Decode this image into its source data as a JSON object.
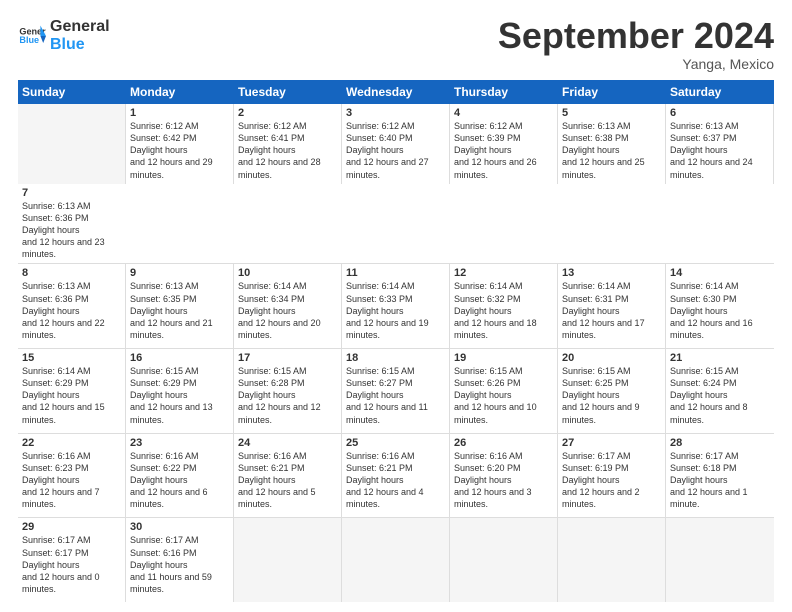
{
  "header": {
    "logo_general": "General",
    "logo_blue": "Blue",
    "month_title": "September 2024",
    "subtitle": "Yanga, Mexico"
  },
  "days": [
    "Sunday",
    "Monday",
    "Tuesday",
    "Wednesday",
    "Thursday",
    "Friday",
    "Saturday"
  ],
  "rows": [
    [
      {
        "day": "",
        "empty": true
      },
      {
        "day": "1",
        "rise": "6:12 AM",
        "set": "6:42 PM",
        "daylight": "12 hours and 29 minutes."
      },
      {
        "day": "2",
        "rise": "6:12 AM",
        "set": "6:41 PM",
        "daylight": "12 hours and 28 minutes."
      },
      {
        "day": "3",
        "rise": "6:12 AM",
        "set": "6:40 PM",
        "daylight": "12 hours and 27 minutes."
      },
      {
        "day": "4",
        "rise": "6:12 AM",
        "set": "6:39 PM",
        "daylight": "12 hours and 26 minutes."
      },
      {
        "day": "5",
        "rise": "6:13 AM",
        "set": "6:38 PM",
        "daylight": "12 hours and 25 minutes."
      },
      {
        "day": "6",
        "rise": "6:13 AM",
        "set": "6:37 PM",
        "daylight": "12 hours and 24 minutes."
      },
      {
        "day": "7",
        "rise": "6:13 AM",
        "set": "6:36 PM",
        "daylight": "12 hours and 23 minutes."
      }
    ],
    [
      {
        "day": "8",
        "rise": "6:13 AM",
        "set": "6:36 PM",
        "daylight": "12 hours and 22 minutes."
      },
      {
        "day": "9",
        "rise": "6:13 AM",
        "set": "6:35 PM",
        "daylight": "12 hours and 21 minutes."
      },
      {
        "day": "10",
        "rise": "6:14 AM",
        "set": "6:34 PM",
        "daylight": "12 hours and 20 minutes."
      },
      {
        "day": "11",
        "rise": "6:14 AM",
        "set": "6:33 PM",
        "daylight": "12 hours and 19 minutes."
      },
      {
        "day": "12",
        "rise": "6:14 AM",
        "set": "6:32 PM",
        "daylight": "12 hours and 18 minutes."
      },
      {
        "day": "13",
        "rise": "6:14 AM",
        "set": "6:31 PM",
        "daylight": "12 hours and 17 minutes."
      },
      {
        "day": "14",
        "rise": "6:14 AM",
        "set": "6:30 PM",
        "daylight": "12 hours and 16 minutes."
      }
    ],
    [
      {
        "day": "15",
        "rise": "6:14 AM",
        "set": "6:29 PM",
        "daylight": "12 hours and 15 minutes."
      },
      {
        "day": "16",
        "rise": "6:15 AM",
        "set": "6:29 PM",
        "daylight": "12 hours and 13 minutes."
      },
      {
        "day": "17",
        "rise": "6:15 AM",
        "set": "6:28 PM",
        "daylight": "12 hours and 12 minutes."
      },
      {
        "day": "18",
        "rise": "6:15 AM",
        "set": "6:27 PM",
        "daylight": "12 hours and 11 minutes."
      },
      {
        "day": "19",
        "rise": "6:15 AM",
        "set": "6:26 PM",
        "daylight": "12 hours and 10 minutes."
      },
      {
        "day": "20",
        "rise": "6:15 AM",
        "set": "6:25 PM",
        "daylight": "12 hours and 9 minutes."
      },
      {
        "day": "21",
        "rise": "6:15 AM",
        "set": "6:24 PM",
        "daylight": "12 hours and 8 minutes."
      }
    ],
    [
      {
        "day": "22",
        "rise": "6:16 AM",
        "set": "6:23 PM",
        "daylight": "12 hours and 7 minutes."
      },
      {
        "day": "23",
        "rise": "6:16 AM",
        "set": "6:22 PM",
        "daylight": "12 hours and 6 minutes."
      },
      {
        "day": "24",
        "rise": "6:16 AM",
        "set": "6:21 PM",
        "daylight": "12 hours and 5 minutes."
      },
      {
        "day": "25",
        "rise": "6:16 AM",
        "set": "6:21 PM",
        "daylight": "12 hours and 4 minutes."
      },
      {
        "day": "26",
        "rise": "6:16 AM",
        "set": "6:20 PM",
        "daylight": "12 hours and 3 minutes."
      },
      {
        "day": "27",
        "rise": "6:17 AM",
        "set": "6:19 PM",
        "daylight": "12 hours and 2 minutes."
      },
      {
        "day": "28",
        "rise": "6:17 AM",
        "set": "6:18 PM",
        "daylight": "12 hours and 1 minute."
      }
    ],
    [
      {
        "day": "29",
        "rise": "6:17 AM",
        "set": "6:17 PM",
        "daylight": "12 hours and 0 minutes."
      },
      {
        "day": "30",
        "rise": "6:17 AM",
        "set": "6:16 PM",
        "daylight": "11 hours and 59 minutes."
      },
      {
        "day": "",
        "empty": true
      },
      {
        "day": "",
        "empty": true
      },
      {
        "day": "",
        "empty": true
      },
      {
        "day": "",
        "empty": true
      },
      {
        "day": "",
        "empty": true
      }
    ]
  ]
}
